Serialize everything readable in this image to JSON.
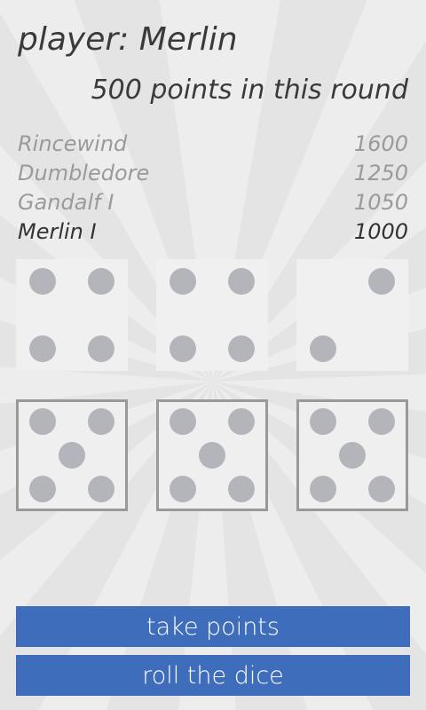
{
  "header": {
    "player_title": "player: Merlin",
    "round_points": "500 points in this round"
  },
  "scoreboard": [
    {
      "name": "Rincewind",
      "score": "1600",
      "current": false
    },
    {
      "name": "Dumbledore",
      "score": "1250",
      "current": false
    },
    {
      "name": "Gandalf  I",
      "score": "1050",
      "current": false
    },
    {
      "name": "Merlin  I",
      "score": "1000",
      "current": true
    }
  ],
  "dice": [
    {
      "value": 4,
      "held": false
    },
    {
      "value": 4,
      "held": false
    },
    {
      "value": 2,
      "held": false
    },
    {
      "value": 5,
      "held": true
    },
    {
      "value": 5,
      "held": true
    },
    {
      "value": 5,
      "held": true
    }
  ],
  "buttons": {
    "take_points": "take points",
    "roll_dice": "roll the dice"
  },
  "colors": {
    "button": "#3e6dbb",
    "pip": "#b3b5bb",
    "background": "#e4e4e4"
  }
}
